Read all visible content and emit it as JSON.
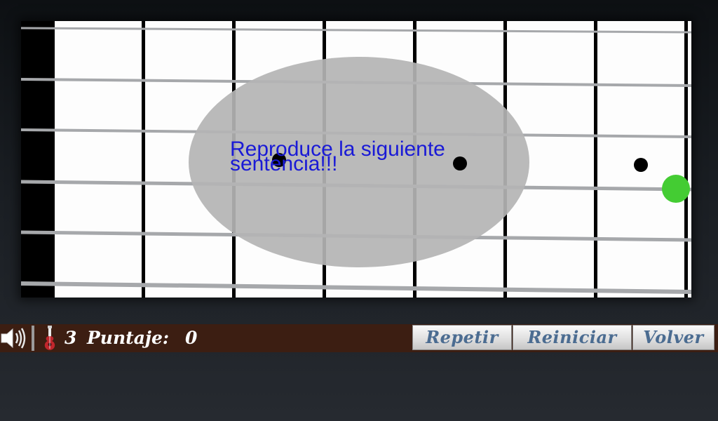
{
  "game": {
    "prompt": "Reproduce la siguiente sentencia!!!",
    "lives": "3",
    "score_label": "Puntaje:",
    "score_value": "0"
  },
  "controls": {
    "repeat_label": "Repetir",
    "restart_label": "Reiniciar",
    "back_label": "Volver"
  },
  "icons": {
    "sound": "speaker-icon",
    "lives": "guitar-icon"
  },
  "colors": {
    "target_note": "#44cc33",
    "hint_text": "#1a1ad6",
    "status_bar": "#3c1e12",
    "button_text": "#4b6c91"
  }
}
